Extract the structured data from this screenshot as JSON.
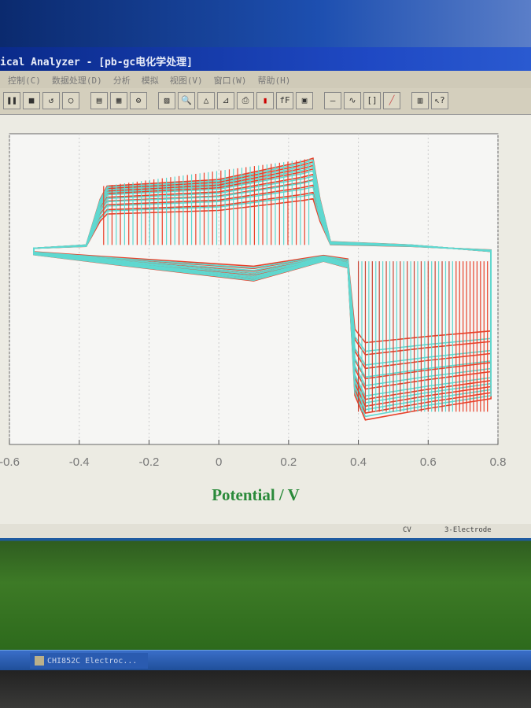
{
  "window": {
    "title": "ical Analyzer - [pb-gc电化学处理]"
  },
  "menu": [
    "控制(C)",
    "数据处理(D)",
    "分析",
    "模拟",
    "视图(V)",
    "窗口(W)",
    "帮助(H)"
  ],
  "toolbar_icons": [
    "pause-icon",
    "stop-icon",
    "undo-icon",
    "circle-icon",
    "grid-icon",
    "table-icon",
    "settings-icon",
    "graph-icon",
    "zoom-icon",
    "peak-icon",
    "mark-icon",
    "print-icon",
    "color-icon",
    "font-icon",
    "save-icon",
    "line-icon",
    "wave-icon",
    "bracket-icon",
    "slope-icon",
    "bars-icon",
    "help-icon"
  ],
  "status": {
    "mode": "CV",
    "electrode": "3-Electrode"
  },
  "taskbar": {
    "task": "CHI852C Electroc..."
  },
  "chart_data": {
    "type": "line",
    "title": "",
    "xlabel": "Potential / V",
    "ylabel": "",
    "xlim": [
      -0.6,
      0.8
    ],
    "ylim": [
      -1.2,
      0.7
    ],
    "xticks": [
      "-0.6",
      "-0.4",
      "-0.2",
      "0",
      "0.2",
      "0.4",
      "0.6",
      "0.8"
    ],
    "grid": true,
    "cycle_template": {
      "x": [
        -0.53,
        -0.38,
        -0.34,
        -0.32,
        0.0,
        0.24,
        0.27,
        0.29,
        0.32,
        0.55,
        0.78,
        0.78,
        0.6,
        0.42,
        0.39,
        0.37,
        0.3,
        0.1,
        -0.3,
        -0.53
      ],
      "y": [
        0.0,
        0.02,
        0.3,
        0.38,
        0.42,
        0.53,
        0.55,
        0.3,
        0.04,
        0.02,
        -0.02,
        -0.92,
        -0.98,
        -1.05,
        -0.9,
        -0.12,
        -0.08,
        -0.2,
        -0.1,
        -0.04
      ]
    },
    "series": [
      {
        "name": "cycles-red",
        "color": "#e8412a",
        "scales": [
          0.55,
          0.62,
          0.7,
          0.76,
          0.82,
          0.88,
          0.92,
          0.96,
          1.0
        ]
      },
      {
        "name": "cycles-cyan",
        "color": "#5fd8d0",
        "scales": [
          0.6,
          0.68,
          0.75,
          0.8,
          0.86,
          0.9,
          0.94,
          0.98
        ]
      }
    ]
  }
}
